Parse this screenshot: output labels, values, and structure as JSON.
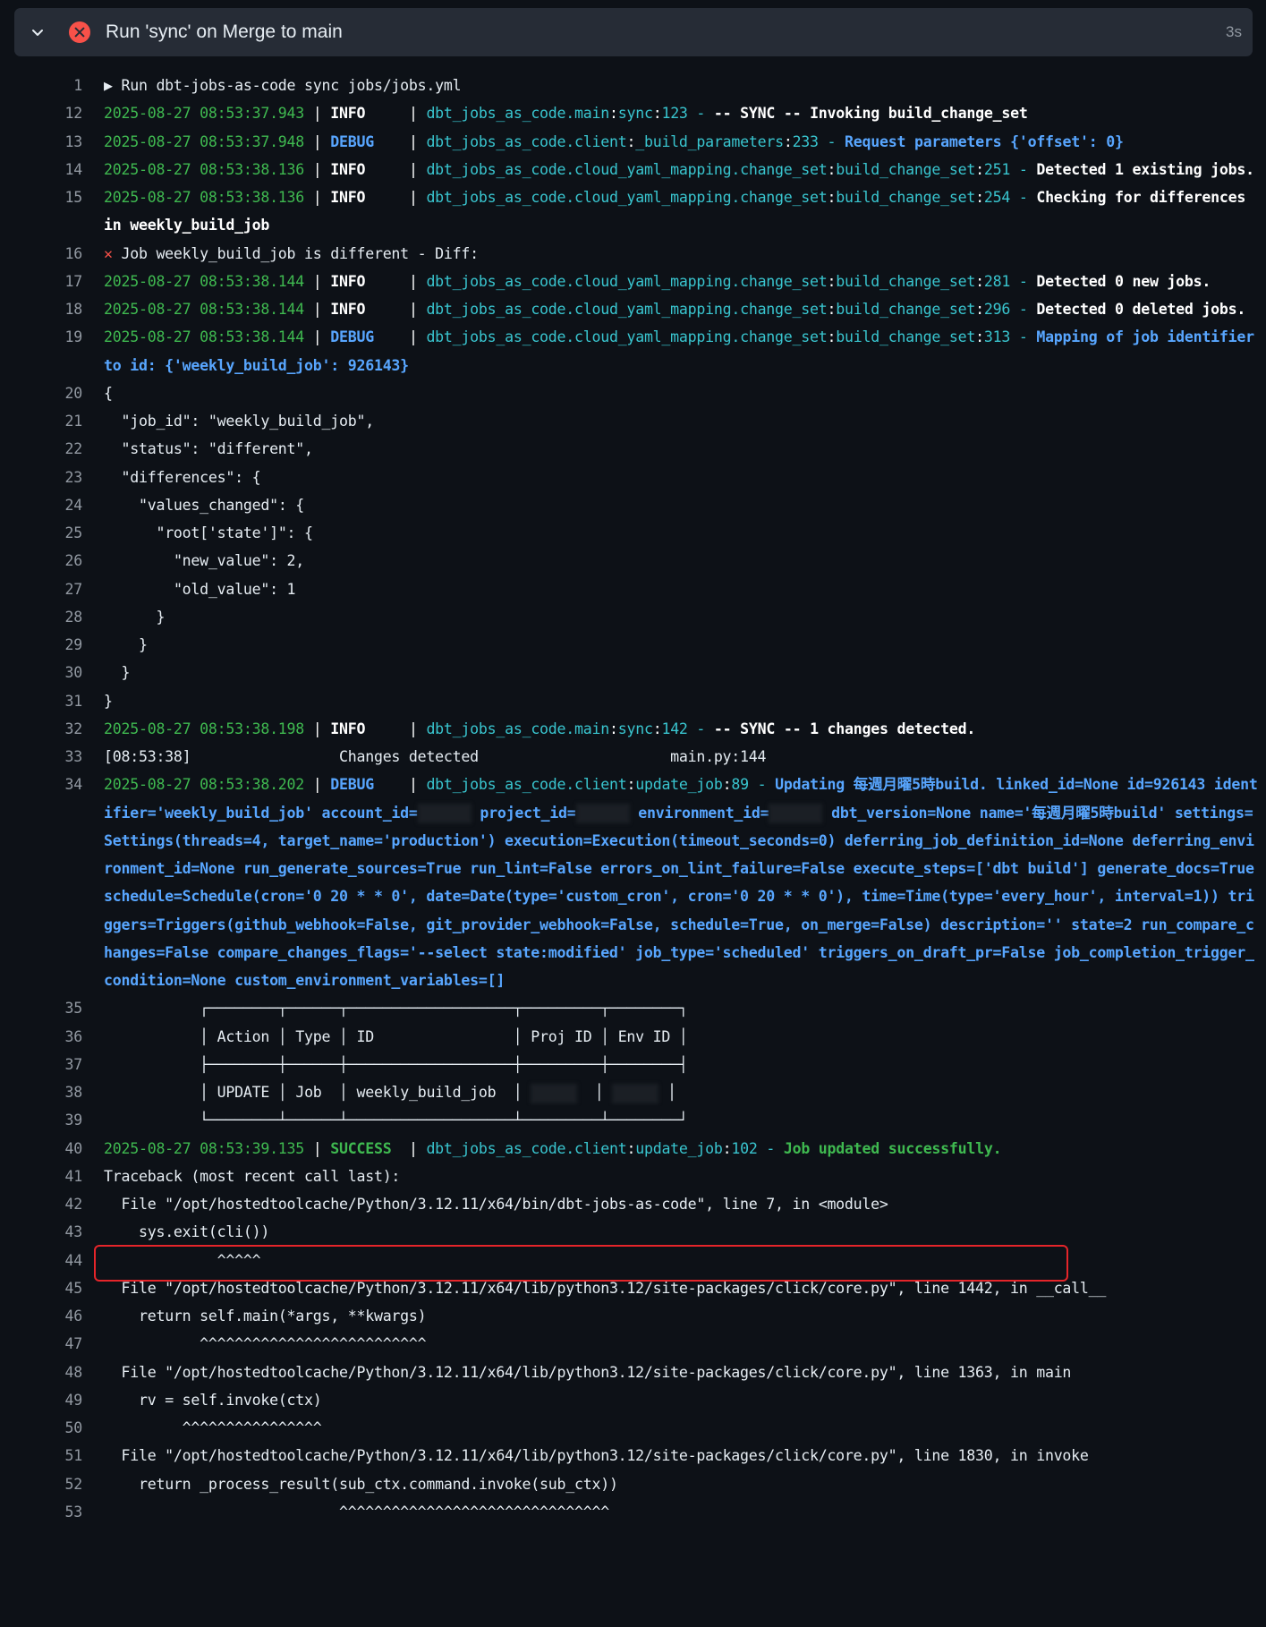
{
  "step": {
    "title": "Run 'sync' on Merge to main",
    "duration": "3s",
    "status_icon": "x-circle-icon",
    "toggle_icon": "chevron-down-icon"
  },
  "lines": [
    {
      "n": "1",
      "text": "▶ Run dbt-jobs-as-code sync jobs/jobs.yml"
    },
    {
      "n": "12",
      "ts": "2025-08-27 08:53:37.943",
      "lvl": "INFO    ",
      "mod": "dbt_jobs_as_code.main",
      "fn": "sync",
      "ln": "123",
      "msg": "-- SYNC -- Invoking build_change_set",
      "kind": "info"
    },
    {
      "n": "13",
      "ts": "2025-08-27 08:53:37.948",
      "lvl": "DEBUG   ",
      "mod": "dbt_jobs_as_code.client",
      "fn": "_build_parameters",
      "ln": "233",
      "msg": "Request parameters {'offset': 0}",
      "kind": "debug"
    },
    {
      "n": "14",
      "ts": "2025-08-27 08:53:38.136",
      "lvl": "INFO    ",
      "mod": "dbt_jobs_as_code.cloud_yaml_mapping.change_set",
      "fn": "build_change_set",
      "ln": "251",
      "msg": "Detected 1 existing jobs.",
      "kind": "info"
    },
    {
      "n": "15",
      "ts": "2025-08-27 08:53:38.136",
      "lvl": "INFO    ",
      "mod": "dbt_jobs_as_code.cloud_yaml_mapping.change_set",
      "fn": "build_change_set",
      "ln": "254",
      "msg": "Checking for differences in weekly_build_job",
      "kind": "info"
    },
    {
      "n": "16",
      "text": "Job weekly_build_job is different - Diff:",
      "icon": "x"
    },
    {
      "n": "17",
      "ts": "2025-08-27 08:53:38.144",
      "lvl": "INFO    ",
      "mod": "dbt_jobs_as_code.cloud_yaml_mapping.change_set",
      "fn": "build_change_set",
      "ln": "281",
      "msg": "Detected 0 new jobs.",
      "kind": "info"
    },
    {
      "n": "18",
      "ts": "2025-08-27 08:53:38.144",
      "lvl": "INFO    ",
      "mod": "dbt_jobs_as_code.cloud_yaml_mapping.change_set",
      "fn": "build_change_set",
      "ln": "296",
      "msg": "Detected 0 deleted jobs.",
      "kind": "info"
    },
    {
      "n": "19",
      "ts": "2025-08-27 08:53:38.144",
      "lvl": "DEBUG   ",
      "mod": "dbt_jobs_as_code.cloud_yaml_mapping.change_set",
      "fn": "build_change_set",
      "ln": "313",
      "msg": "Mapping of job identifier to id: {'weekly_build_job': 926143}",
      "kind": "debug"
    },
    {
      "n": "20",
      "text": "{"
    },
    {
      "n": "21",
      "text": "  \"job_id\": \"weekly_build_job\","
    },
    {
      "n": "22",
      "text": "  \"status\": \"different\","
    },
    {
      "n": "23",
      "text": "  \"differences\": {"
    },
    {
      "n": "24",
      "text": "    \"values_changed\": {"
    },
    {
      "n": "25",
      "text": "      \"root['state']\": {"
    },
    {
      "n": "26",
      "text": "        \"new_value\": 2,"
    },
    {
      "n": "27",
      "text": "        \"old_value\": 1"
    },
    {
      "n": "28",
      "text": "      }"
    },
    {
      "n": "29",
      "text": "    }"
    },
    {
      "n": "30",
      "text": "  }"
    },
    {
      "n": "31",
      "text": "}"
    },
    {
      "n": "32",
      "ts": "2025-08-27 08:53:38.198",
      "lvl": "INFO    ",
      "mod": "dbt_jobs_as_code.main",
      "fn": "sync",
      "ln": "142",
      "msg": "-- SYNC -- 1 changes detected.",
      "kind": "info"
    },
    {
      "n": "33",
      "text": "[08:53:38]                 Changes detected                      main.py:144"
    },
    {
      "n": "34",
      "ts": "2025-08-27 08:53:38.202",
      "lvl": "DEBUG   ",
      "mod": "dbt_jobs_as_code.client",
      "fn": "update_job",
      "ln": "89",
      "kind": "debug",
      "msg_parts": [
        "Updating 每週月曜5時build. linked_id=None id=926143 identifier='weekly_build_job' account_id=",
        "REDACT",
        " project_id=",
        "REDACT",
        " environment_id=",
        "REDACT",
        " dbt_version=None name='每週月曜5時build' settings=Settings(threads=4, target_name='production') execution=Execution(timeout_seconds=0) deferring_job_definition_id=None deferring_environment_id=None run_generate_sources=True run_lint=False errors_on_lint_failure=False execute_steps=['dbt build'] generate_docs=True schedule=Schedule(cron='0 20 * * 0', date=Date(type='custom_cron', cron='0 20 * * 0'), time=Time(type='every_hour', interval=1)) triggers=Triggers(github_webhook=False, git_provider_webhook=False, schedule=True, on_merge=False) description='' state=2 run_compare_changes=False compare_changes_flags='--select state:modified' job_type='scheduled' triggers_on_draft_pr=False job_completion_trigger_condition=None custom_environment_variables=[]"
      ]
    },
    {
      "n": "35",
      "text": "           ┌────────┬──────┬───────────────────┬─────────┬────────┐"
    },
    {
      "n": "36",
      "text": "           │ Action │ Type │ ID                │ Proj ID │ Env ID │"
    },
    {
      "n": "37",
      "text": "           ├────────┼──────┼───────────────────┼─────────┼────────┤"
    },
    {
      "n": "38",
      "table_row": true,
      "cells": [
        "UPDATE",
        "Job",
        "weekly_build_job"
      ]
    },
    {
      "n": "39",
      "text": "           └────────┴──────┴───────────────────┴─────────┴────────┘"
    },
    {
      "n": "40",
      "ts": "2025-08-27 08:53:39.135",
      "lvl": "SUCCESS ",
      "mod": "dbt_jobs_as_code.client",
      "fn": "update_job",
      "ln": "102",
      "msg": "Job updated successfully.",
      "kind": "success"
    },
    {
      "n": "41",
      "text": "Traceback (most recent call last):"
    },
    {
      "n": "42",
      "text": "  File \"/opt/hostedtoolcache/Python/3.12.11/x64/bin/dbt-jobs-as-code\", line 7, in <module>"
    },
    {
      "n": "43",
      "text": "    sys.exit(cli())"
    },
    {
      "n": "44",
      "text": "             ^^^^^"
    },
    {
      "n": "45",
      "text": "  File \"/opt/hostedtoolcache/Python/3.12.11/x64/lib/python3.12/site-packages/click/core.py\", line 1442, in __call__"
    },
    {
      "n": "46",
      "text": "    return self.main(*args, **kwargs)"
    },
    {
      "n": "47",
      "text": "           ^^^^^^^^^^^^^^^^^^^^^^^^^^"
    },
    {
      "n": "48",
      "text": "  File \"/opt/hostedtoolcache/Python/3.12.11/x64/lib/python3.12/site-packages/click/core.py\", line 1363, in main"
    },
    {
      "n": "49",
      "text": "    rv = self.invoke(ctx)"
    },
    {
      "n": "50",
      "text": "         ^^^^^^^^^^^^^^^^"
    },
    {
      "n": "51",
      "text": "  File \"/opt/hostedtoolcache/Python/3.12.11/x64/lib/python3.12/site-packages/click/core.py\", line 1830, in invoke"
    },
    {
      "n": "52",
      "text": "    return _process_result(sub_ctx.command.invoke(sub_ctx))"
    },
    {
      "n": "53",
      "text": "                           ^^^^^^^^^^^^^^^^^^^^^^^^^^^^^^^"
    }
  ]
}
